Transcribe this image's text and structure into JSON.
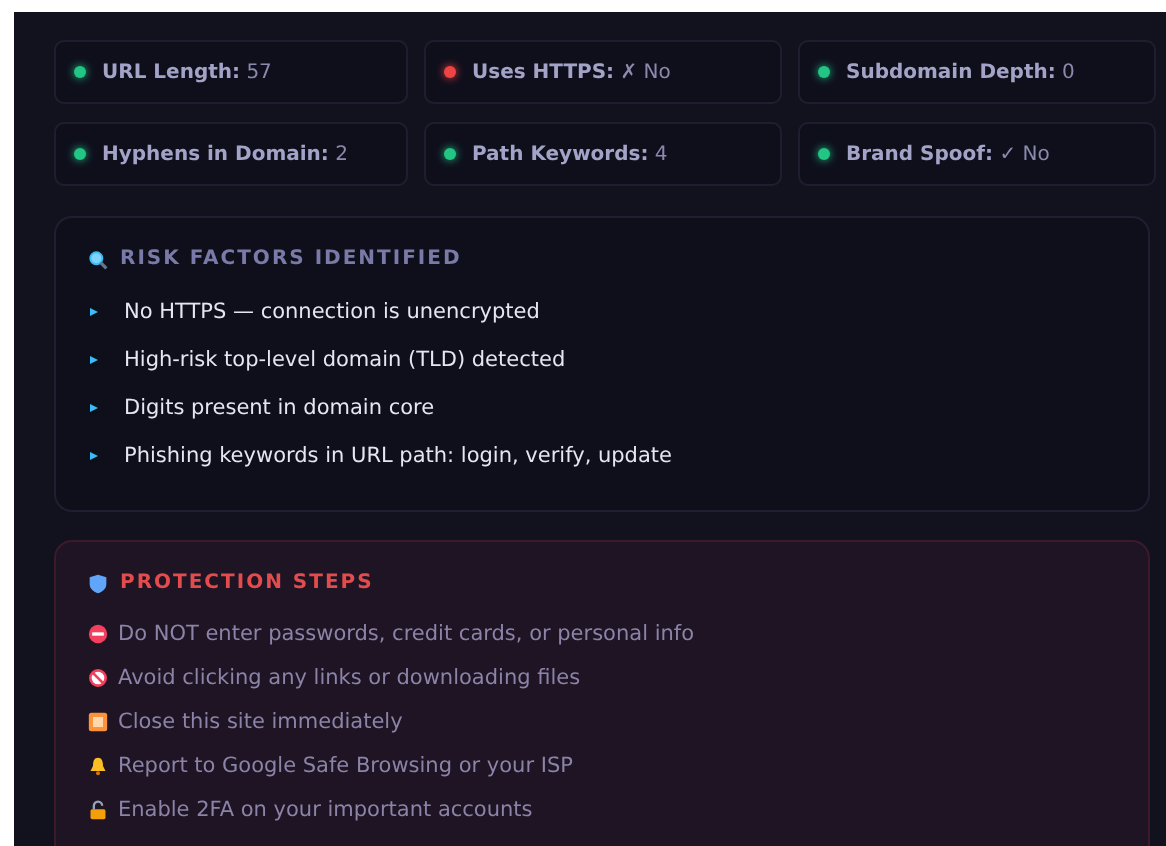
{
  "metrics": [
    {
      "label": "URL Length:",
      "value": "57",
      "color": "#22c583"
    },
    {
      "label": "Uses HTTPS:",
      "value": "✗ No",
      "color": "#ef4444"
    },
    {
      "label": "Subdomain Depth:",
      "value": "0",
      "color": "#22c583"
    },
    {
      "label": "Hyphens in Domain:",
      "value": "2",
      "color": "#22c583"
    },
    {
      "label": "Path Keywords:",
      "value": "4",
      "color": "#22c583"
    },
    {
      "label": "Brand Spoof:",
      "value": "✓ No",
      "color": "#22c583"
    }
  ],
  "risk_factors": {
    "title": "RISK FACTORS IDENTIFIED",
    "items": [
      "No HTTPS — connection is unencrypted",
      "High-risk top-level domain (TLD) detected",
      "Digits present in domain core",
      "Phishing keywords in URL path: login, verify, update"
    ]
  },
  "protection_steps": {
    "title": "PROTECTION STEPS",
    "items": [
      {
        "kind": "no-entry",
        "text": "Do NOT enter passwords, credit cards, or personal info"
      },
      {
        "kind": "prohibited",
        "text": "Avoid clicking any links or downloading files"
      },
      {
        "kind": "stop",
        "text": "Close this site immediately"
      },
      {
        "kind": "bell",
        "text": "Report to Google Safe Browsing or your ISP"
      },
      {
        "kind": "lock",
        "text": "Enable 2FA on your important accounts"
      }
    ]
  }
}
